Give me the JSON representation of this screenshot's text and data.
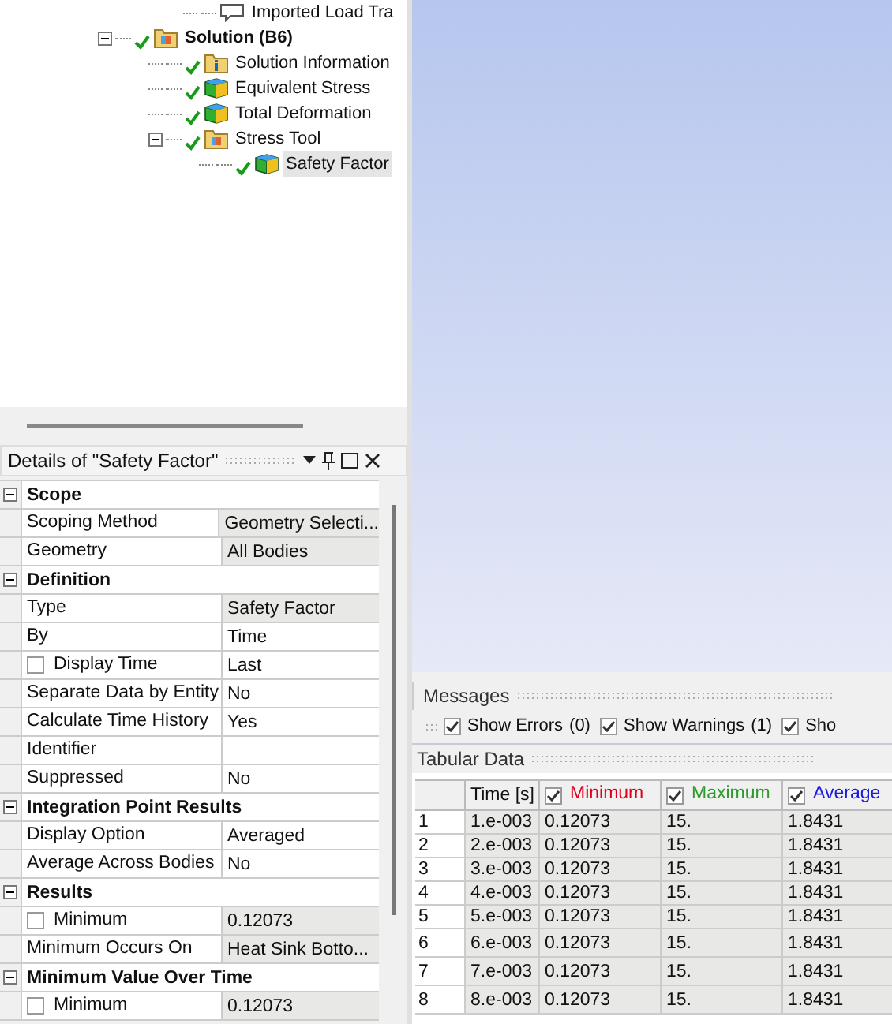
{
  "tree": [
    {
      "label": "Imported Load Tra",
      "kind": "load",
      "selected": false
    },
    {
      "label": "Solution (B6)",
      "kind": "folder",
      "bold": true,
      "selected": false,
      "expanded": true,
      "children": [
        {
          "label": "Solution Information",
          "kind": "info",
          "selected": false
        },
        {
          "label": "Equivalent Stress",
          "kind": "result",
          "selected": false
        },
        {
          "label": "Total Deformation",
          "kind": "result",
          "selected": false
        },
        {
          "label": "Stress Tool",
          "kind": "folder",
          "selected": false,
          "expanded": true,
          "children": [
            {
              "label": "Safety Factor",
              "kind": "result",
              "selected": true
            }
          ]
        }
      ]
    }
  ],
  "details": {
    "title": "Details of \"Safety Factor\"",
    "rows": [
      {
        "kind": "section",
        "name": "Scope",
        "expanded": true
      },
      {
        "kind": "prop",
        "name": "Scoping Method",
        "value": "Geometry Selecti...",
        "readonly": true
      },
      {
        "kind": "prop",
        "name": "Geometry",
        "value": "All Bodies",
        "readonly": true
      },
      {
        "kind": "section",
        "name": "Definition",
        "expanded": true
      },
      {
        "kind": "prop",
        "name": "Type",
        "value": "Safety Factor",
        "readonly": true
      },
      {
        "kind": "prop",
        "name": "By",
        "value": "Time",
        "readonly": false
      },
      {
        "kind": "check",
        "name": "Display Time",
        "value": "Last",
        "readonly": false,
        "checked": false
      },
      {
        "kind": "prop",
        "name": "Separate Data by Entity",
        "value": "No",
        "readonly": false
      },
      {
        "kind": "prop",
        "name": "Calculate Time History",
        "value": "Yes",
        "readonly": false
      },
      {
        "kind": "prop",
        "name": "Identifier",
        "readonly": false
      },
      {
        "kind": "prop",
        "name": "Suppressed",
        "value": "No",
        "readonly": false
      },
      {
        "kind": "section",
        "name": "Integration Point Results",
        "expanded": true
      },
      {
        "kind": "prop",
        "name": "Display Option",
        "value": "Averaged",
        "readonly": false
      },
      {
        "kind": "prop",
        "name": "Average Across Bodies",
        "value": "No",
        "readonly": false
      },
      {
        "kind": "section",
        "name": "Results",
        "expanded": true
      },
      {
        "kind": "check",
        "name": "Minimum",
        "value": "0.12073",
        "readonly": true,
        "checked": false
      },
      {
        "kind": "prop",
        "name": "Minimum Occurs On",
        "value": "Heat Sink Botto...",
        "readonly": true
      },
      {
        "kind": "section",
        "name": "Minimum Value Over Time",
        "expanded": true
      },
      {
        "kind": "check",
        "name": "Minimum",
        "value": "0.12073",
        "readonly": true,
        "checked": false
      }
    ]
  },
  "messages": {
    "title": "Messages",
    "filters": [
      {
        "label": "Show Errors",
        "count": "(0)",
        "checked": true
      },
      {
        "label": "Show Warnings",
        "count": "(1)",
        "checked": true
      },
      {
        "label": "Sho",
        "checked": true
      }
    ]
  },
  "tabular": {
    "title": "Tabular Data",
    "columns": [
      {
        "label": "Time [s]",
        "kind": "plain"
      },
      {
        "label": "Minimum",
        "kind": "check",
        "checked": true,
        "color": "#e0001b"
      },
      {
        "label": "Maximum",
        "kind": "check",
        "checked": true,
        "color": "#2e9a2e"
      },
      {
        "label": "Average",
        "kind": "check",
        "checked": true,
        "color": "#1a1ae0"
      }
    ],
    "rows": [
      {
        "index": "1",
        "cells": [
          "1.e-003",
          "0.12073",
          "15.",
          "1.8431"
        ]
      },
      {
        "index": "2",
        "cells": [
          "2.e-003",
          "0.12073",
          "15.",
          "1.8431"
        ]
      },
      {
        "index": "3",
        "cells": [
          "3.e-003",
          "0.12073",
          "15.",
          "1.8431"
        ]
      },
      {
        "index": "4",
        "cells": [
          "4.e-003",
          "0.12073",
          "15.",
          "1.8431"
        ]
      },
      {
        "index": "5",
        "cells": [
          "5.e-003",
          "0.12073",
          "15.",
          "1.8431"
        ]
      },
      {
        "index": "6",
        "cells": [
          "6.e-003",
          "0.12073",
          "15.",
          "1.8431"
        ]
      },
      {
        "index": "7",
        "cells": [
          "7.e-003",
          "0.12073",
          "15.",
          "1.8431"
        ]
      },
      {
        "index": "8",
        "cells": [
          "8.e-003",
          "0.12073",
          "15.",
          "1.8431"
        ]
      }
    ]
  }
}
